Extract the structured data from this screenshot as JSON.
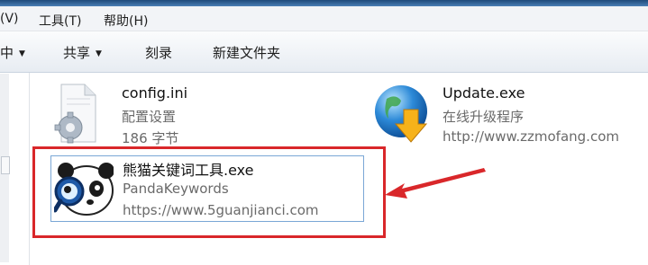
{
  "menubar": {
    "view": "(V)",
    "tools": "工具(T)",
    "help": "帮助(H)"
  },
  "toolbar": {
    "partial": "中",
    "share": "共享",
    "burn": "刻录",
    "new_folder": "新建文件夹"
  },
  "files": [
    {
      "name": "config.ini",
      "type": "配置设置",
      "size": "186 字节",
      "icon": "config-file-gear-icon"
    },
    {
      "name": "Update.exe",
      "type": "在线升级程序",
      "company": "http://www.zzmofang.com",
      "icon": "globe-download-arrow-icon"
    },
    {
      "name": "熊猫关键词工具.exe",
      "type": "PandaKeywords",
      "company": "https://www.5guanjianci.com",
      "icon": "panda-magnifier-icon"
    }
  ],
  "annotation": {
    "highlight_color": "#d9272a"
  }
}
